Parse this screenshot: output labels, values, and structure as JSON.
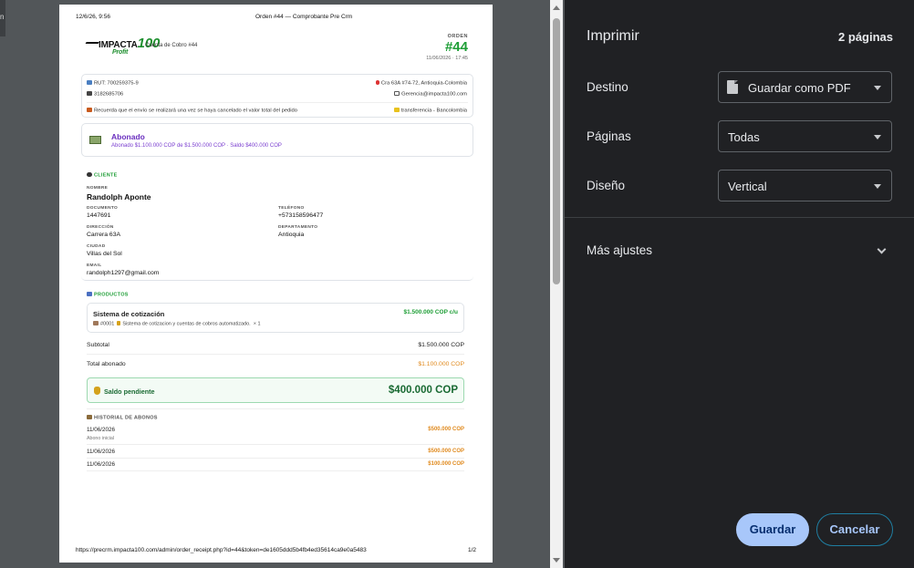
{
  "print_header": {
    "datetime": "12/6/26, 9:56",
    "title": "Orden #44 — Comprobante Pre Crm"
  },
  "print_footer": {
    "url": "https://precrm.impacta100.com/admin/order_receipt.php?id=44&token=de1605ddd5b4fb4ed35614ca9e0a5483",
    "page": "1/2"
  },
  "doc": {
    "logo_text": "IMPACTA",
    "logo_num": "100",
    "logo_sub": "Profit",
    "cuenta": "Cuenta de Cobro #44",
    "orden_label": "ORDEN",
    "orden_num": "#44",
    "orden_date": "11/06/2026 · 17:45",
    "rut": "RUT: 700259375-9",
    "phone": "3182685706",
    "address": "Cra 63A #74-72, Antioquia-Colombia",
    "email": "Gerencia@impacta100.com",
    "envio_note": "Recuerda que el envío se realizará una vez se haya cancelado el valor total del pedido",
    "payment": "transferencia - Bancolombia",
    "abono_title": "Abonado",
    "abono_desc": "Abonado $1.100.000 COP de $1.500.000 COP · Saldo $400.000 COP",
    "cliente": {
      "title": "CLIENTE",
      "nombre_label": "NOMBRE",
      "nombre": "Randolph Aponte",
      "documento_label": "DOCUMENTO",
      "documento": "1447691",
      "telefono_label": "TELÉFONO",
      "telefono": "+573158596477",
      "direccion_label": "DIRECCIÓN",
      "direccion": "Carrera 63A",
      "departamento_label": "DEPARTAMENTO",
      "departamento": "Antioquia",
      "ciudad_label": "CIUDAD",
      "ciudad": "Villas del Sol",
      "email_label": "EMAIL",
      "email": "randolph1297@gmail.com"
    },
    "productos": {
      "title": "PRODUCTOS",
      "name": "Sistema de cotización",
      "price": "$1.500.000 COP c/u",
      "code": "#0001",
      "desc": "Sistema de cotizacion y cuentas de cobros automatizado.",
      "qty": "× 1"
    },
    "subtotal_label": "Subtotal",
    "subtotal": "$1.500.000 COP",
    "total_abonado_label": "Total abonado",
    "total_abonado": "$1.100.000 COP",
    "saldo_label": "Saldo pendiente",
    "saldo": "$400.000 COP",
    "historial": {
      "title": "HISTORIAL DE ABONOS",
      "items": [
        {
          "date": "11/06/2026",
          "amount": "$500.000 COP",
          "note": "Abono inicial"
        },
        {
          "date": "11/06/2026",
          "amount": "$500.000 COP",
          "note": ""
        },
        {
          "date": "11/06/2026",
          "amount": "$100.000 COP",
          "note": ""
        }
      ]
    }
  },
  "panel": {
    "title": "Imprimir",
    "pages_count": "2 páginas",
    "destino_label": "Destino",
    "destino_value": "Guardar como PDF",
    "paginas_label": "Páginas",
    "paginas_value": "Todas",
    "diseno_label": "Diseño",
    "diseno_value": "Vertical",
    "more_settings": "Más ajustes",
    "save_label": "Guardar",
    "cancel_label": "Cancelar"
  },
  "colors": {
    "panel_bg": "#202124",
    "accent_button": "#a8c7fa",
    "green": "#1e9e36",
    "purple": "#6a2fbf",
    "orange": "#e08a1e"
  }
}
